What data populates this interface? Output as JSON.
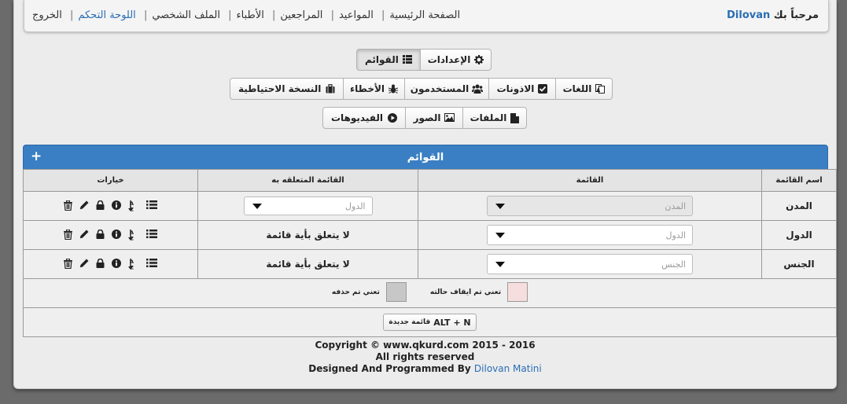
{
  "header": {
    "welcome_prefix": "مرحباً بك",
    "username": "Dilovan",
    "links": [
      {
        "label": "الصفحة الرئيسية",
        "active": false
      },
      {
        "label": "المواعيد",
        "active": false
      },
      {
        "label": "المراجعين",
        "active": false
      },
      {
        "label": "الأطباء",
        "active": false
      },
      {
        "label": "الملف الشخصي",
        "active": false
      },
      {
        "label": "اللوحة التحكم",
        "active": true
      },
      {
        "label": "الخروج",
        "active": false
      }
    ]
  },
  "toolbar1": {
    "settings": "الإعدادات",
    "lists": "القوائم"
  },
  "toolbar2": {
    "languages": "اللغات",
    "permissions": "الاذونات",
    "users": "المستخدمون",
    "errors": "الأخطاء",
    "backup": "النسخة الاحتياطية"
  },
  "toolbar3": {
    "files": "الملفات",
    "images": "الصور",
    "videos": "الفيديوهات"
  },
  "panel": {
    "title": "القوائم",
    "add_icon": "+"
  },
  "table": {
    "headers": {
      "name": "اسم القائمة",
      "list": "القائمة",
      "related": "القائمة المتعلقه به",
      "options": "خيارات"
    },
    "rows": [
      {
        "name": "المدن",
        "list_value": "المدن",
        "list_disabled": true,
        "related_select": "الدول",
        "related_text": ""
      },
      {
        "name": "الدول",
        "list_value": "الدول",
        "list_disabled": false,
        "related_select": "",
        "related_text": "لا يتعلق بأية قائمة"
      },
      {
        "name": "الجنس",
        "list_value": "الجنس",
        "list_disabled": false,
        "related_select": "",
        "related_text": "لا يتعلق بأية قائمة"
      }
    ]
  },
  "legend": {
    "disabled_label": "تعني تم ايقاف حالته",
    "deleted_label": "تعني تم حذفه",
    "disabled_color": "#f6dede",
    "deleted_color": "#c7c7c7"
  },
  "new_list": {
    "shortcut": "ALT + N",
    "label": "قائمة جديدة"
  },
  "footer": {
    "line1": "Copyright © www.qkurd.com 2015 - 2016",
    "line2": "All rights reserved",
    "line3_prefix": "Designed And Programmed By",
    "author": "Dilovan Matini"
  },
  "colors": {
    "accent": "#3a7fc4",
    "link": "#2a6db5"
  }
}
